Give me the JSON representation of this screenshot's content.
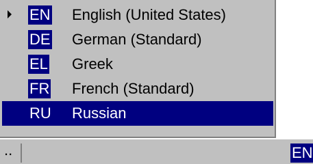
{
  "menu": {
    "items": [
      {
        "code": "EN",
        "label": "English (United States)",
        "checked": true,
        "selected": false
      },
      {
        "code": "DE",
        "label": "German (Standard)",
        "checked": false,
        "selected": false
      },
      {
        "code": "EL",
        "label": "Greek",
        "checked": false,
        "selected": false
      },
      {
        "code": "FR",
        "label": "French (Standard)",
        "checked": false,
        "selected": false
      },
      {
        "code": "RU",
        "label": "Russian",
        "checked": false,
        "selected": true
      }
    ]
  },
  "taskbar": {
    "left_text": "..",
    "language_indicator": "EN"
  },
  "colors": {
    "menu_bg": "#c0c0c0",
    "highlight": "#000080",
    "highlight_text": "#ffffff"
  }
}
